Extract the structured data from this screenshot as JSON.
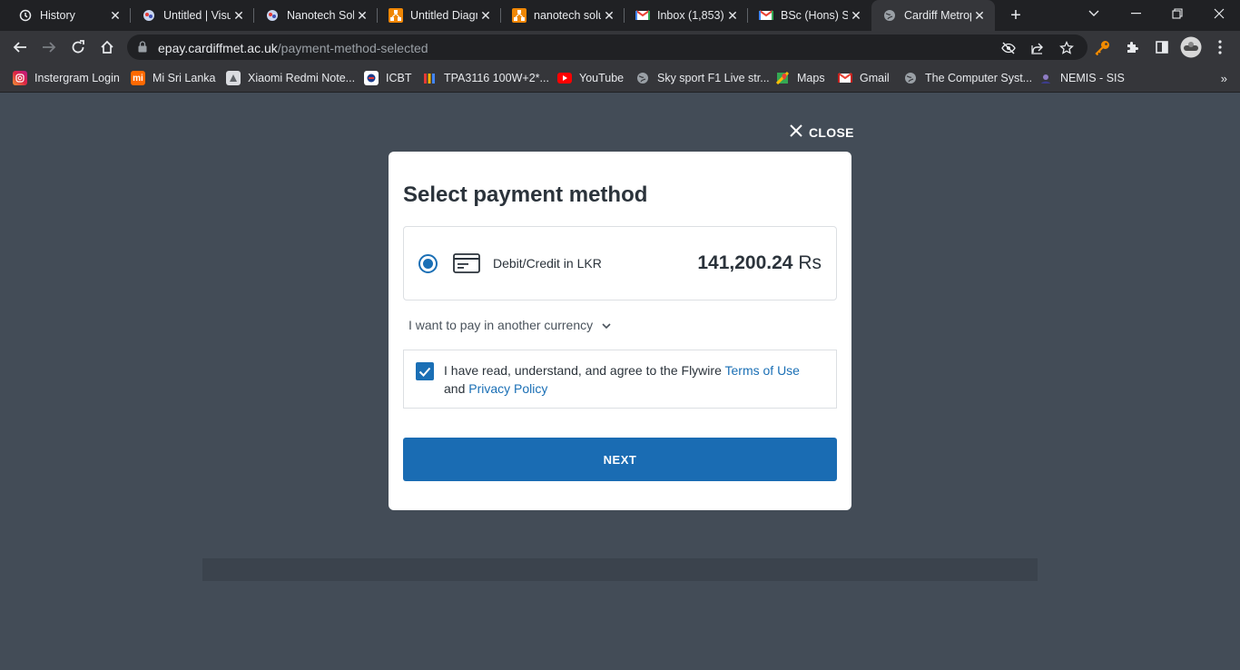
{
  "tabs": [
    {
      "title": "History",
      "icon": "history-icon"
    },
    {
      "title": "Untitled | Visual Paradigm Online",
      "icon": "visual-paradigm-icon"
    },
    {
      "title": "Nanotech Solutions | Visual Paradigm Online",
      "icon": "visual-paradigm-icon"
    },
    {
      "title": "Untitled Diagram - draw.io",
      "icon": "drawio-icon"
    },
    {
      "title": "nanotech solutions - draw.io",
      "icon": "drawio-icon"
    },
    {
      "title": "Inbox (1,853)",
      "icon": "gmail-icon"
    },
    {
      "title": "BSc (Hons) Software Engineering",
      "icon": "gmail-icon"
    },
    {
      "title": "Cardiff Metropolitan University",
      "icon": "globe-icon"
    }
  ],
  "address_bar": {
    "domain": "epay.cardiffmet.ac.uk",
    "path": "/payment-method-selected"
  },
  "bookmarks": [
    {
      "label": "Instergram Login",
      "icon": "instagram-icon",
      "color": "#d6249f"
    },
    {
      "label": "Mi Sri Lanka",
      "icon": "mi-icon",
      "color": "#ff6900"
    },
    {
      "label": "Xiaomi Redmi Note...",
      "icon": "xiaomi-icon",
      "color": "#9aa0a6"
    },
    {
      "label": "ICBT",
      "icon": "icbt-icon",
      "color": "#ffffff"
    },
    {
      "label": "TPA3116 100W+2*...",
      "icon": "amplifier-icon",
      "color": "#f4b400"
    },
    {
      "label": "YouTube",
      "icon": "youtube-icon",
      "color": "#ff0000"
    },
    {
      "label": "Sky sport F1 Live str...",
      "icon": "globe-icon",
      "color": "#9aa0a6"
    },
    {
      "label": "Maps",
      "icon": "maps-icon",
      "color": "#34a853"
    },
    {
      "label": "Gmail",
      "icon": "gmail-icon",
      "color": "#ea4335"
    },
    {
      "label": "The Computer Syst...",
      "icon": "globe-icon",
      "color": "#9aa0a6"
    },
    {
      "label": "NEMIS - SIS",
      "icon": "nemis-icon",
      "color": "#6a5acd"
    }
  ],
  "page": {
    "close_label": "CLOSE",
    "modal_title": "Select payment method",
    "option_label": "Debit/Credit in LKR",
    "amount_value": "141,200.24",
    "amount_currency": "Rs",
    "currency_link": "I want to pay in another currency",
    "terms_prefix": "I have read, understand, and agree to the Flywire ",
    "terms_link": "Terms of Use",
    "terms_and": " and ",
    "privacy_link": "Privacy Policy",
    "next_label": "NEXT"
  },
  "colors": {
    "accent": "#1a6cb3",
    "overlay": "#434c57"
  }
}
